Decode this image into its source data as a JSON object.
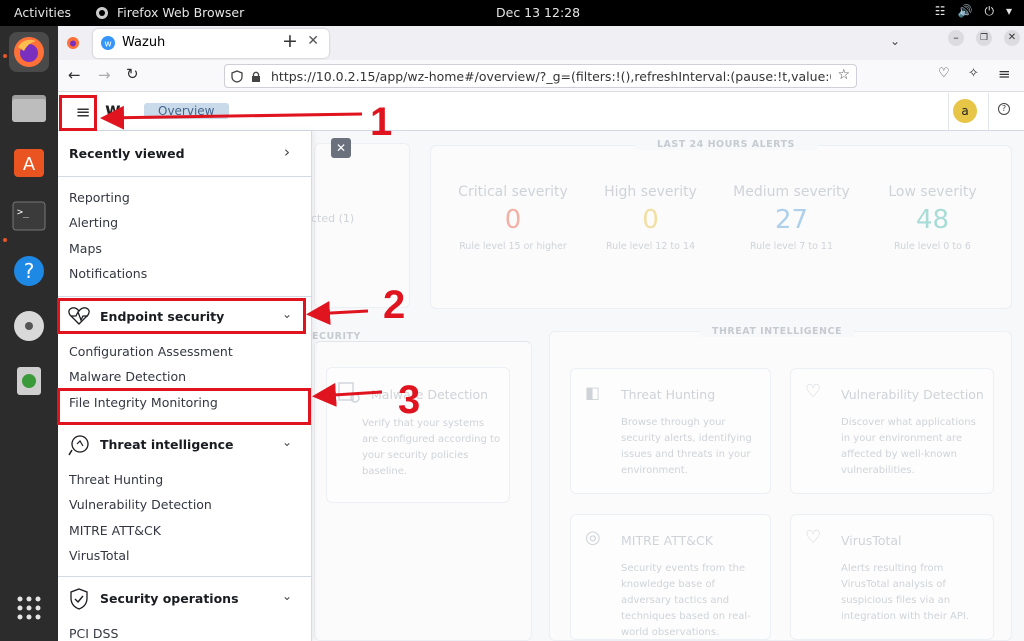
{
  "os": {
    "activities": "Activities",
    "app_name": "Firefox Web Browser",
    "clock": "Dec 13  12:28"
  },
  "browser": {
    "tab_title": "Wazuh",
    "url": "https://10.0.2.15/app/wz-home#/overview/?_g=(filters:!(),refreshInterval:(pause:!t,value:0),time:(fro"
  },
  "app": {
    "logo": "w",
    "breadcrumb": "Overview",
    "avatar": "a"
  },
  "alerts": {
    "section_title": "LAST 24 HOURS ALERTS",
    "behind_text": "cted (1)",
    "items": [
      {
        "label": "Critical severity",
        "value": "0",
        "sub": "Rule level 15 or higher",
        "color": "#f3b1a6"
      },
      {
        "label": "High severity",
        "value": "0",
        "sub": "Rule level 12 to 14",
        "color": "#f2dfa2"
      },
      {
        "label": "Medium severity",
        "value": "27",
        "sub": "Rule level 7 to 11",
        "color": "#aed0ea"
      },
      {
        "label": "Low severity",
        "value": "48",
        "sub": "Rule level 0 to 6",
        "color": "#a8dcd6"
      }
    ]
  },
  "sections": {
    "endpoint_partial": "ECURITY",
    "threat_intel": "THREAT INTELLIGENCE"
  },
  "cards": {
    "malware": {
      "title": "Malware Detection",
      "desc": "Verify that your systems are configured according to your security policies baseline."
    },
    "threat_hunting": {
      "title": "Threat Hunting",
      "desc": "Browse through your security alerts, identifying issues and threats in your environment."
    },
    "vulnerability": {
      "title": "Vulnerability Detection",
      "desc": "Discover what applications in your environment are affected by well-known vulnerabilities."
    },
    "mitre": {
      "title": "MITRE ATT&CK",
      "desc": "Security events from the knowledge base of adversary tactics and techniques based on real-world observations."
    },
    "virustotal": {
      "title": "VirusTotal",
      "desc": "Alerts resulting from VirusTotal analysis of suspicious files via an integration with their API."
    }
  },
  "menu": {
    "recently_viewed": "Recently viewed",
    "recent_items": [
      "Reporting",
      "Alerting",
      "Maps",
      "Notifications"
    ],
    "endpoint_security": "Endpoint security",
    "endpoint_items": [
      "Configuration Assessment",
      "Malware Detection",
      "File Integrity Monitoring"
    ],
    "threat_intelligence": "Threat intelligence",
    "threat_items": [
      "Threat Hunting",
      "Vulnerability Detection",
      "MITRE ATT&CK",
      "VirusTotal"
    ],
    "security_operations": "Security operations",
    "secops_items": [
      "PCI DSS"
    ]
  },
  "annotations": {
    "step1": "1",
    "step2": "2",
    "step3": "3",
    "color": "#e0141e"
  }
}
